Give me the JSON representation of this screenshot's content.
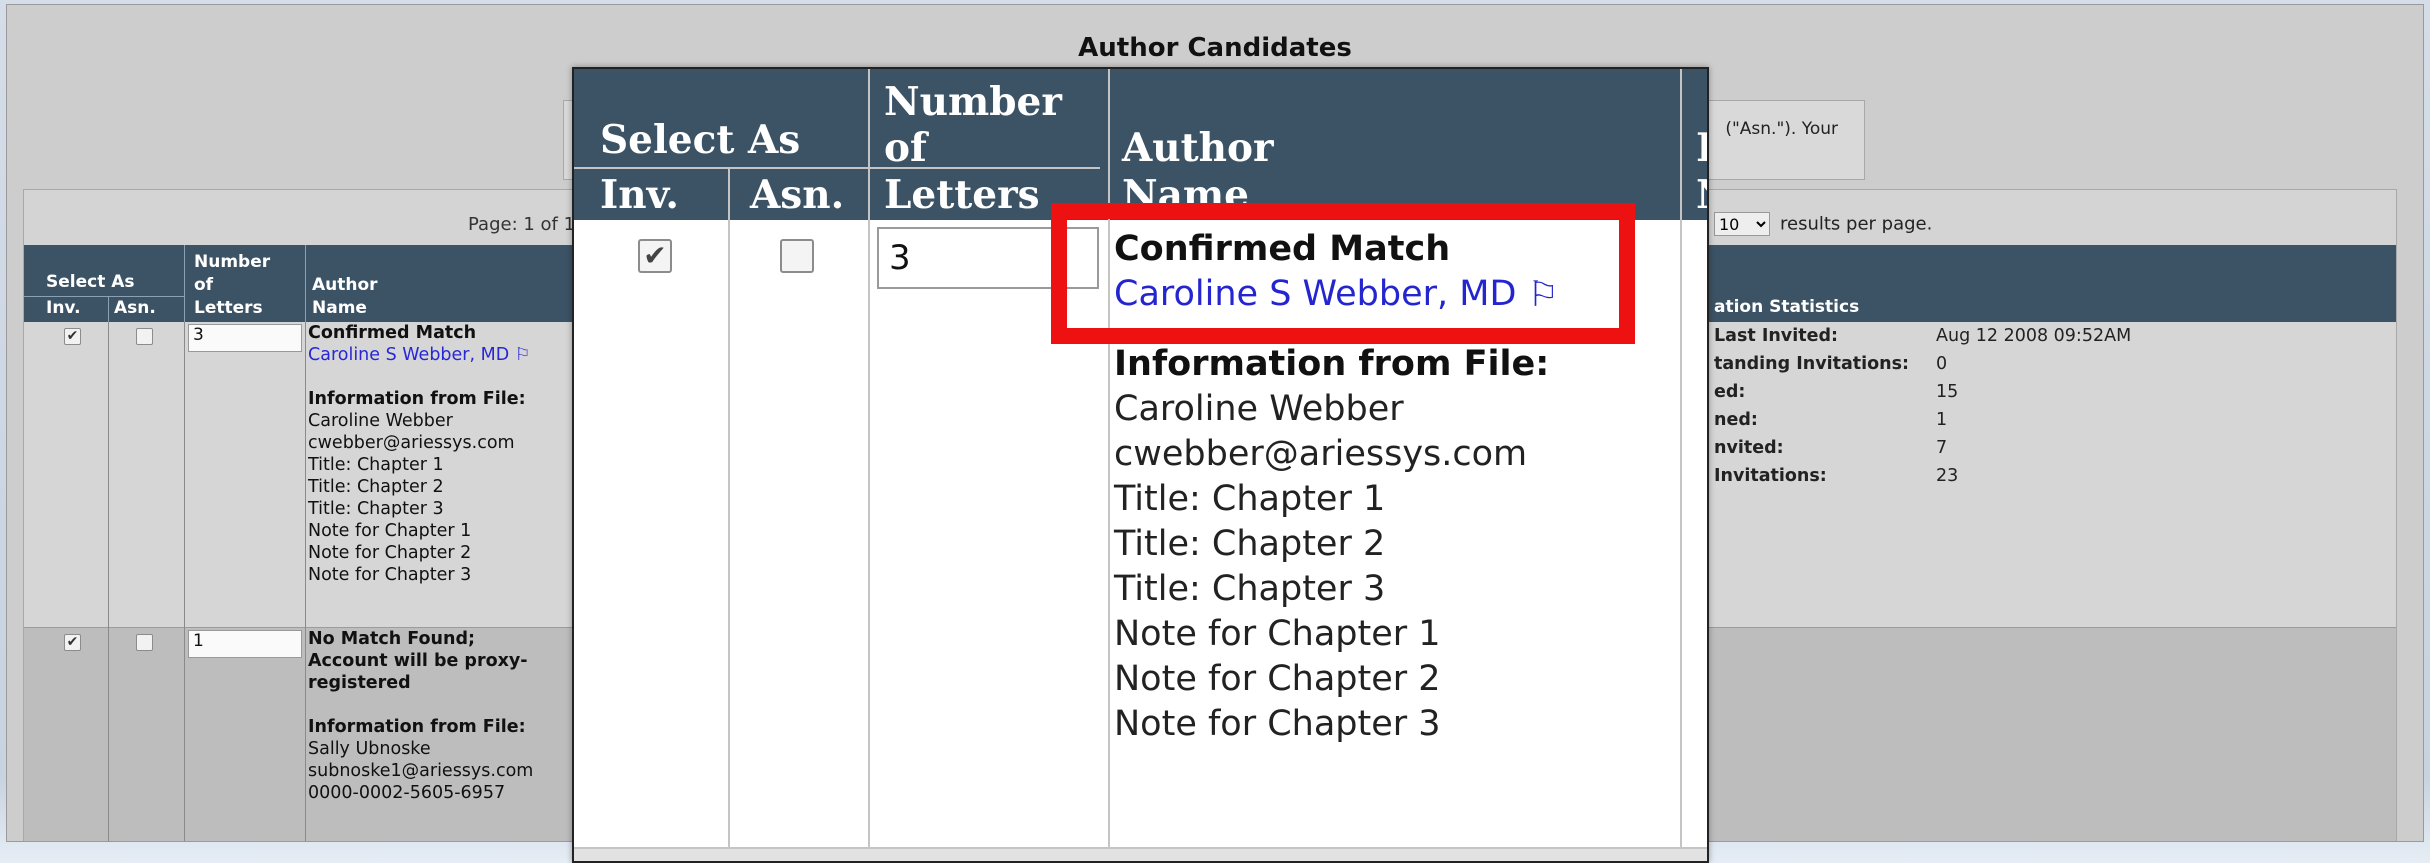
{
  "page": {
    "title": "Author Candidates"
  },
  "notice": {
    "text": "(\"Asn.\"). Your"
  },
  "pager": {
    "label": "Page: 1 of 1"
  },
  "per_page": {
    "selected": "10",
    "suffix": "results per page."
  },
  "table": {
    "header": {
      "select_as": "Select As",
      "inv": "Inv.",
      "asn": "Asn.",
      "number_of_letters": [
        "Number",
        "of",
        "Letters"
      ],
      "author_name": [
        "Author",
        "Name"
      ],
      "stats_title": "ation Statistics"
    },
    "rows": [
      {
        "inv_checked": true,
        "asn_checked": false,
        "letters": "3",
        "status": "Confirmed Match",
        "author_link": "Caroline S Webber, MD",
        "info_title": "Information from File:",
        "info_lines": [
          "Caroline Webber",
          "cwebber@ariessys.com",
          "Title: Chapter 1",
          "Title: Chapter 2",
          "Title: Chapter 3",
          "Note for Chapter 1",
          "Note for Chapter 2",
          "Note for Chapter 3"
        ]
      },
      {
        "inv_checked": true,
        "asn_checked": false,
        "letters": "1",
        "status_lines": [
          "No Match Found;",
          "Account will be proxy-",
          "registered"
        ],
        "info_title": "Information from File:",
        "info_lines": [
          "Sally Ubnoske",
          "subnoske1@ariessys.com",
          "0000-0002-5605-6957"
        ]
      }
    ],
    "stats": [
      {
        "label": "Last Invited:",
        "value": "Aug 12 2008 09:52AM"
      },
      {
        "label": "tanding Invitations:",
        "value": "0"
      },
      {
        "label": "ed:",
        "value": "15"
      },
      {
        "label": "ned:",
        "value": "1"
      },
      {
        "label": "nvited:",
        "value": "7"
      },
      {
        "label": "Invitations:",
        "value": "23"
      }
    ]
  },
  "zoom": {
    "header": {
      "select_as": "Select As",
      "inv": "Inv.",
      "asn": "Asn.",
      "number": "Number",
      "of": "of",
      "letters": "Letters",
      "author": "Author",
      "name": "Name",
      "partial_1": "E",
      "partial_2": "N"
    },
    "row": {
      "letters": "3",
      "status": "Confirmed Match",
      "author_link": "Caroline S Webber, MD",
      "info_title": "Information from File:",
      "info_lines": [
        "Caroline Webber",
        "cwebber@ariessys.com",
        "Title: Chapter 1",
        "Title: Chapter 2",
        "Title: Chapter 3",
        "Note for Chapter 1",
        "Note for Chapter 2",
        "Note for Chapter 3"
      ]
    },
    "next_row_partial": "No Match Found"
  },
  "colors": {
    "header_bg": "#3c5366",
    "link": "#2727d6",
    "highlight": "#ee1111"
  }
}
